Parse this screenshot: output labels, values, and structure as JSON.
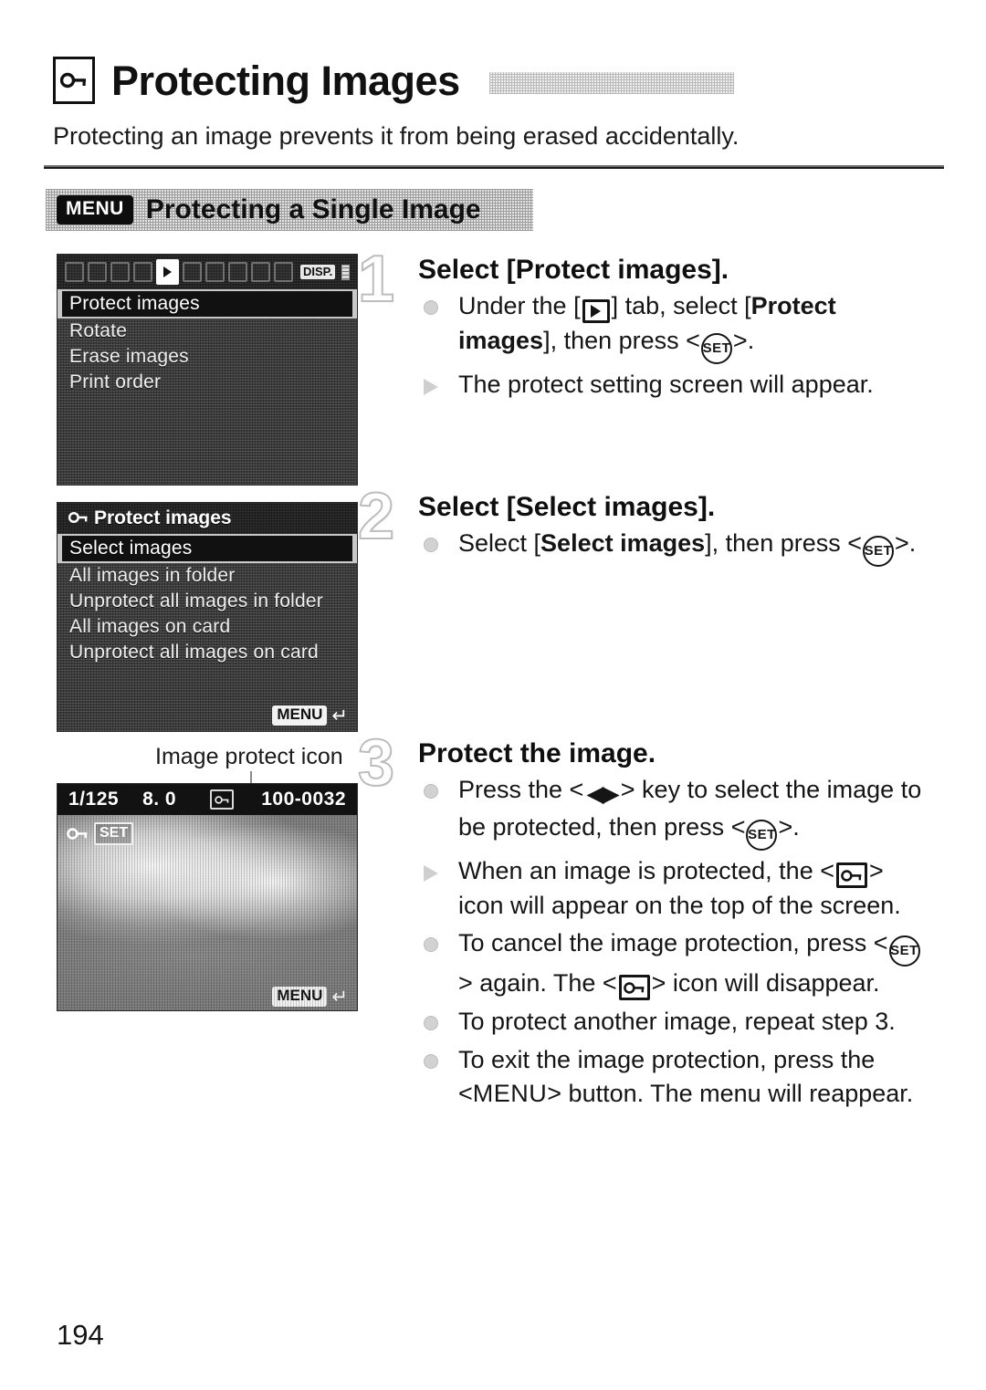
{
  "document": {
    "page_number": "194",
    "title": "Protecting Images",
    "title_icon": "protect-key-icon",
    "intro": "Protecting an image prevents it from being erased accidentally.",
    "section": {
      "badge": "MENU",
      "heading": "Protecting a Single Image"
    }
  },
  "screens": {
    "playback_menu": {
      "tab_active": "playback-tab-icon",
      "disp_label": "DISP.",
      "items": [
        "Protect images",
        "Rotate",
        "Erase images",
        "Print order"
      ],
      "selected_index": 0
    },
    "protect_images": {
      "header": "Protect images",
      "header_icon": "protect-key-icon",
      "items": [
        "Select images",
        "All images in folder",
        "Unprotect all images in folder",
        "All images on card",
        "Unprotect all images on card"
      ],
      "selected_index": 0,
      "footer_badge": "MENU",
      "footer_arrow": "↵"
    },
    "image_review": {
      "callout": "Image protect icon",
      "shutter_speed": "1/125",
      "aperture": "8. 0",
      "file_number": "100-0032",
      "protect_icon": "image-protect-icon",
      "set_label": "SET",
      "protect_overlay_icon": "protect-key-icon",
      "footer_badge": "MENU",
      "footer_arrow": "↵"
    }
  },
  "steps": [
    {
      "number": "1",
      "title": "Select [Protect images].",
      "bullets": [
        {
          "marker": "dot",
          "segments": [
            {
              "t": "text",
              "v": "Under the ["
            },
            {
              "t": "icon",
              "v": "playback-tab-icon"
            },
            {
              "t": "text",
              "v": "] tab, select ["
            },
            {
              "t": "bold",
              "v": "Protect images"
            },
            {
              "t": "text",
              "v": "], then press <"
            },
            {
              "t": "icon",
              "v": "set-button-icon"
            },
            {
              "t": "text",
              "v": ">."
            }
          ]
        },
        {
          "marker": "triangle",
          "segments": [
            {
              "t": "text",
              "v": "The protect setting screen will appear."
            }
          ]
        }
      ]
    },
    {
      "number": "2",
      "title": "Select [Select images].",
      "bullets": [
        {
          "marker": "dot",
          "segments": [
            {
              "t": "text",
              "v": "Select ["
            },
            {
              "t": "bold",
              "v": "Select images"
            },
            {
              "t": "text",
              "v": "], then press <"
            },
            {
              "t": "icon",
              "v": "set-button-icon"
            },
            {
              "t": "text",
              "v": ">."
            }
          ]
        }
      ]
    },
    {
      "number": "3",
      "title": "Protect the image.",
      "bullets": [
        {
          "marker": "dot",
          "segments": [
            {
              "t": "text",
              "v": "Press the <"
            },
            {
              "t": "icon",
              "v": "left-right-key-icon"
            },
            {
              "t": "text",
              "v": "> key to select the image to be protected, then press <"
            },
            {
              "t": "icon",
              "v": "set-button-icon"
            },
            {
              "t": "text",
              "v": ">."
            }
          ]
        },
        {
          "marker": "triangle",
          "segments": [
            {
              "t": "text",
              "v": "When an image is protected, the <"
            },
            {
              "t": "icon",
              "v": "protect-key-icon"
            },
            {
              "t": "text",
              "v": "> icon will appear on the top of the screen."
            }
          ]
        },
        {
          "marker": "dot",
          "segments": [
            {
              "t": "text",
              "v": "To cancel the image protection, press <"
            },
            {
              "t": "icon",
              "v": "set-button-icon"
            },
            {
              "t": "text",
              "v": "> again. The <"
            },
            {
              "t": "icon",
              "v": "protect-key-icon"
            },
            {
              "t": "text",
              "v": "> icon will disappear."
            }
          ]
        },
        {
          "marker": "dot",
          "segments": [
            {
              "t": "text",
              "v": "To protect another image, repeat step 3."
            }
          ]
        },
        {
          "marker": "dot",
          "segments": [
            {
              "t": "text",
              "v": "To exit the image protection, press the <"
            },
            {
              "t": "menuword",
              "v": "MENU"
            },
            {
              "t": "text",
              "v": "> button. The menu will reappear."
            }
          ]
        }
      ]
    }
  ],
  "labels": {
    "set_button_text": "SET"
  },
  "colors": {
    "ink": "#111111",
    "band_gray": "#e4e4e4",
    "screen_dark": "#2a2a2a",
    "step_number_outline": "#bdbdbd"
  }
}
